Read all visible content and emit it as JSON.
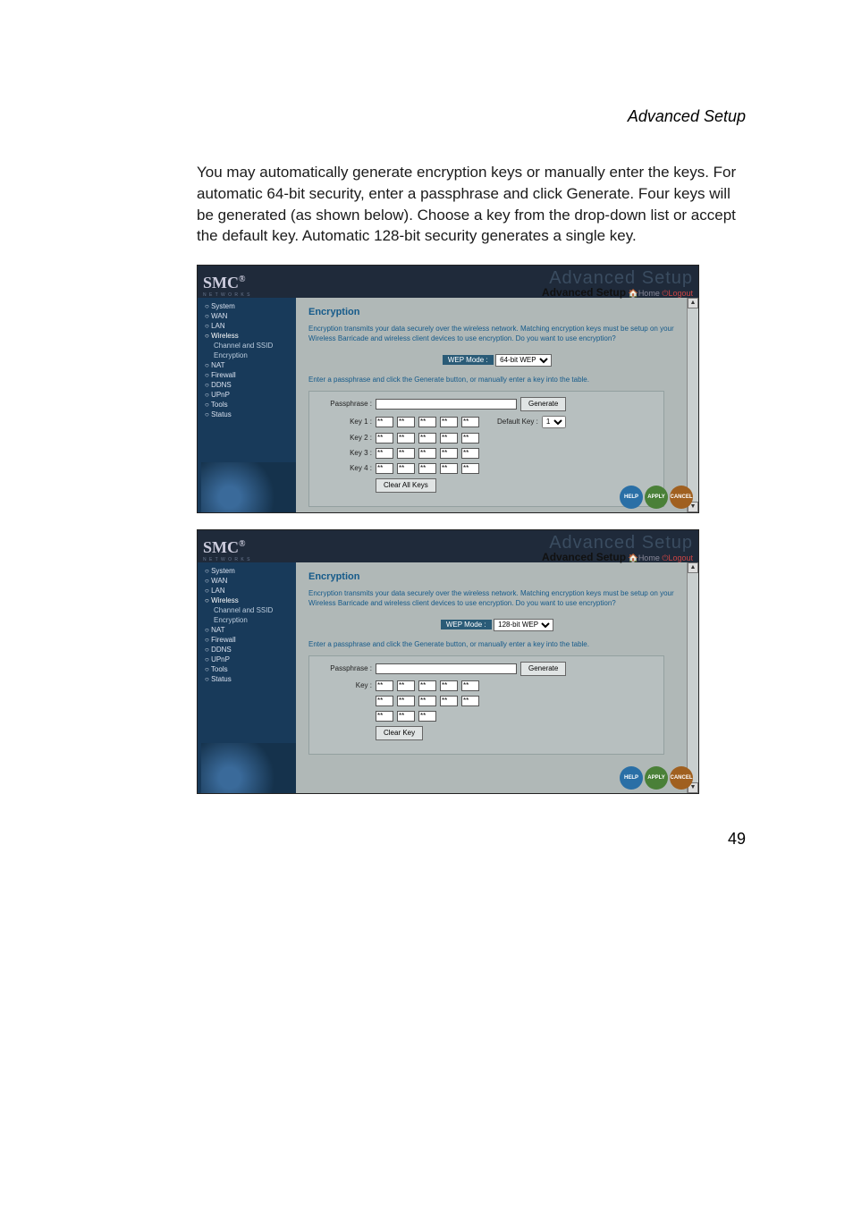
{
  "page": {
    "header": "Advanced Setup",
    "intro": "You may automatically generate encryption keys or manually enter the keys. For automatic 64-bit security, enter a passphrase and click Generate. Four keys will be generated (as shown below). Choose a key from the drop-down list or accept the default key. Automatic 128-bit security generates a single key.",
    "number": "49"
  },
  "shot": {
    "brand": "SMC",
    "brand_sup": "®",
    "brand_sub": "N E T W O R K S",
    "ghost_title": "Advanced Setup",
    "banner_title": "Advanced Setup",
    "home_icon": "🏠",
    "home_label": "Home",
    "logout_icon": "⏻",
    "logout_label": "Logout",
    "nav": {
      "system": "System",
      "wan": "WAN",
      "lan": "LAN",
      "wireless": "Wireless",
      "wireless_channel": "Channel and SSID",
      "wireless_encryption": "Encryption",
      "nat": "NAT",
      "firewall": "Firewall",
      "ddns": "DDNS",
      "upnp": "UPnP",
      "tools": "Tools",
      "status": "Status"
    },
    "main_title": "Encryption",
    "desc": "Encryption transmits your data securely over the wireless network. Matching encryption keys must be setup on your Wireless Barricade and wireless client devices to use encryption. Do you want to use encryption?",
    "wep_mode_label": "WEP Mode :",
    "instr": "Enter a passphrase and click the Generate button, or manually enter a key into the table.",
    "passphrase_label": "Passphrase :",
    "generate_btn": "Generate",
    "key_labels": [
      "Key 1 :",
      "Key 2 :",
      "Key 3 :",
      "Key 4 :"
    ],
    "key_fill": "**",
    "default_key_label": "Default Key :",
    "default_key_value": "1",
    "clear_all_btn": "Clear All Keys",
    "key_single_label": "Key :",
    "clear_key_btn": "Clear Key",
    "btn_help": "HELP",
    "btn_apply": "APPLY",
    "btn_cancel": "CANCEL"
  },
  "wep_modes": {
    "bit64": "64-bit WEP",
    "bit128": "128-bit WEP"
  },
  "chart_data": {
    "type": "table",
    "wep_64bit": {
      "passphrase": "",
      "keys": [
        [
          "**",
          "**",
          "**",
          "**",
          "**"
        ],
        [
          "**",
          "**",
          "**",
          "**",
          "**"
        ],
        [
          "**",
          "**",
          "**",
          "**",
          "**"
        ],
        [
          "**",
          "**",
          "**",
          "**",
          "**"
        ]
      ],
      "default_key": 1
    },
    "wep_128bit": {
      "passphrase": "",
      "key_grid": [
        [
          "**",
          "**",
          "**",
          "**",
          "**"
        ],
        [
          "**",
          "**",
          "**",
          "**",
          "**"
        ],
        [
          "**",
          "**",
          "**"
        ]
      ]
    }
  }
}
